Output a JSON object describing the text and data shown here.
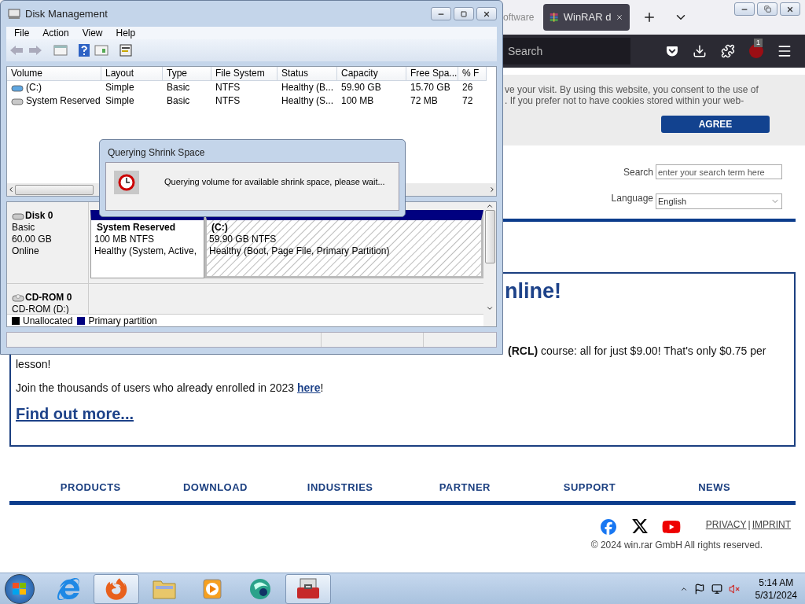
{
  "browser": {
    "tabs": [
      {
        "label": "oftware",
        "selected": false
      },
      {
        "label": "WinRAR d",
        "selected": true
      }
    ],
    "search": {
      "placeholder": "Search"
    },
    "extension_badge": "1",
    "cookie_banner": {
      "lines": [
        "ve your visit. By using this website, you consent to the use of",
        ". If you prefer not to have cookies stored within your web-"
      ],
      "button": "AGREE"
    },
    "site_search": {
      "label": "Search",
      "placeholder": "enter your search term here"
    },
    "language": {
      "label": "Language",
      "value": "English"
    },
    "promo": {
      "heading": "nline!",
      "lines": [
        "**(RCL)** course: all for just $9.00! That's only $0.75 per",
        "lesson!"
      ],
      "join": {
        "text": "Join the thousands of users who already enrolled in 2023 ",
        "link": "here",
        "end": "!"
      },
      "more": "Find out more..."
    },
    "nav": [
      "PRODUCTS",
      "DOWNLOAD",
      "INDUSTRIES",
      "PARTNER",
      "SUPPORT",
      "NEWS"
    ],
    "footer": {
      "links": [
        "PRIVACY",
        "IMPRINT"
      ],
      "separator": "|",
      "copyright": "© 2024 win.rar GmbH All rights reserved."
    }
  },
  "disk_management": {
    "title": "Disk Management",
    "menu": [
      "File",
      "Action",
      "View",
      "Help"
    ],
    "columns": [
      "Volume",
      "Layout",
      "Type",
      "File System",
      "Status",
      "Capacity",
      "Free Spa...",
      "% F"
    ],
    "rows": [
      {
        "kind": "boot",
        "cells": [
          "(C:)",
          "Simple",
          "Basic",
          "NTFS",
          "Healthy (B...",
          "59.90 GB",
          "15.70 GB",
          "26"
        ]
      },
      {
        "kind": "reserved",
        "cells": [
          "System Reserved",
          "Simple",
          "Basic",
          "NTFS",
          "Healthy (S...",
          "100 MB",
          "72 MB",
          "72"
        ]
      }
    ],
    "disks": [
      {
        "kind": "disk",
        "name": "Disk 0",
        "lines": [
          "Basic",
          "60.00 GB",
          "Online"
        ],
        "partitions": [
          {
            "name": "System Reserved",
            "size": "100 MB NTFS",
            "status": "Healthy (System, Active,",
            "selected": false
          },
          {
            "name": "(C:)",
            "size": "59.90 GB NTFS",
            "status": "Healthy (Boot, Page File, Primary Partition)",
            "selected": true
          }
        ]
      },
      {
        "kind": "cdrom",
        "name": "CD-ROM 0",
        "lines": [
          "CD-ROM (D:)"
        ]
      }
    ],
    "legend": [
      {
        "label": "Unallocated",
        "color": "#000000"
      },
      {
        "label": "Primary partition",
        "color": "#000080"
      }
    ]
  },
  "dialog": {
    "title": "Querying Shrink Space",
    "message": "Querying volume for available shrink space, please wait..."
  },
  "taskbar": {
    "apps": [
      {
        "kind": "ie",
        "open": false
      },
      {
        "kind": "firefox",
        "open": true
      },
      {
        "kind": "folder",
        "open": false
      },
      {
        "kind": "media",
        "open": false
      },
      {
        "kind": "orb",
        "open": false
      },
      {
        "kind": "toolbox",
        "open": true
      }
    ],
    "time": "5:14 AM",
    "date": "5/31/2024"
  }
}
